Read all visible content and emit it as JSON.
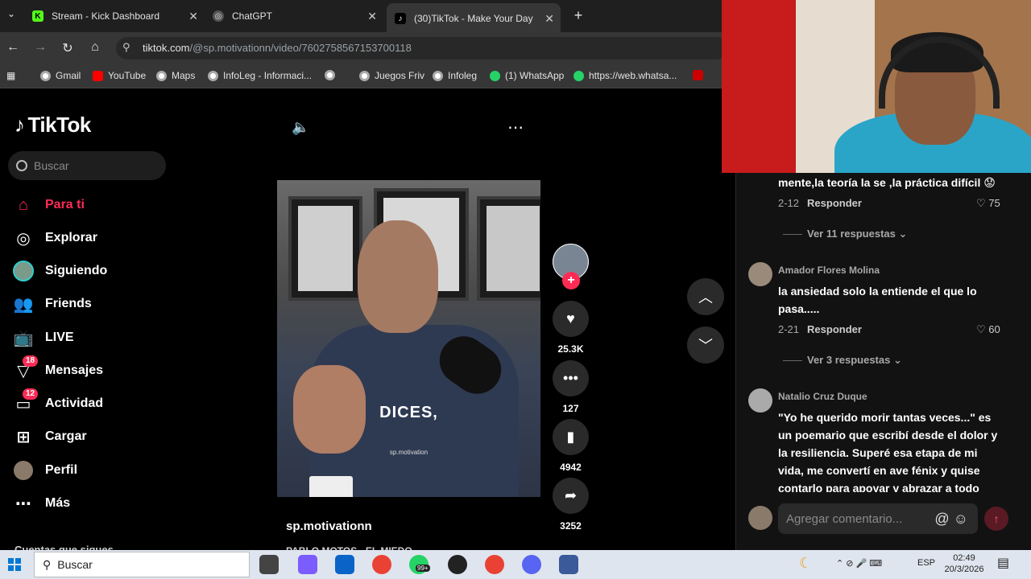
{
  "tabs": [
    {
      "title": "Stream - Kick Dashboard",
      "icon": "kick-icon"
    },
    {
      "title": "ChatGPT",
      "icon": "chatgpt-icon"
    },
    {
      "title": "(30)TikTok - Make Your Day",
      "icon": "tiktok-icon"
    }
  ],
  "url": {
    "host": "tiktok.com",
    "path": "/@sp.motivationn/video/7602758567153700118"
  },
  "bookmarks": [
    "Gmail",
    "YouTube",
    "Maps",
    "InfoLeg - Informaci...",
    "",
    "Juegos Friv",
    "Infoleg",
    "(1) WhatsApp",
    "https://web.whatsa..."
  ],
  "sidebar": {
    "logo": "TikTok",
    "search_placeholder": "Buscar",
    "items": [
      {
        "label": "Para ti",
        "icon": "home-icon",
        "active": true
      },
      {
        "label": "Explorar",
        "icon": "compass-icon"
      },
      {
        "label": "Siguiendo",
        "icon": "following-avatar-icon"
      },
      {
        "label": "Friends",
        "icon": "friends-icon"
      },
      {
        "label": "LIVE",
        "icon": "live-icon"
      },
      {
        "label": "Mensajes",
        "icon": "messages-icon",
        "badge": "18"
      },
      {
        "label": "Actividad",
        "icon": "activity-icon",
        "badge": "12"
      },
      {
        "label": "Cargar",
        "icon": "upload-icon"
      },
      {
        "label": "Perfil",
        "icon": "profile-avatar-icon"
      },
      {
        "label": "Más",
        "icon": "more-icon"
      }
    ],
    "following_header": "Cuentas que sigues"
  },
  "video": {
    "caption": "DICES,",
    "watermark": "sp.motivation",
    "author": "sp.motivationn",
    "description": "PABLO MOTOS - EL MIEDO..."
  },
  "actions": {
    "likes": "25.3K",
    "comments": "127",
    "saves": "4942",
    "shares": "3252"
  },
  "comments": [
    {
      "text": "mente,la teoría la se ,la práctica difícil 😟",
      "date": "2-12",
      "reply": "Responder",
      "likes": "75",
      "replies": "Ver 11 respuestas"
    },
    {
      "name": "Amador Flores Molina",
      "text": "la ansiedad solo la entiende el que lo pasa.....",
      "date": "2-21",
      "reply": "Responder",
      "likes": "60",
      "replies": "Ver 3 respuestas"
    },
    {
      "name": "Natalio Cruz Duque",
      "text": "\"Yo he querido morir tantas veces...\" es un poemario que escribí desde el dolor y la resiliencia. Superé esa etapa de mi vida, me convertí en ave fénix y quise contarlo para apoyar y abrazar a todo"
    }
  ],
  "comment_input": {
    "placeholder": "Agregar comentario..."
  },
  "taskbar": {
    "search": "Buscar",
    "lang": "ESP",
    "time": "02:49",
    "date": "20/3/2026",
    "badge": "99+"
  }
}
